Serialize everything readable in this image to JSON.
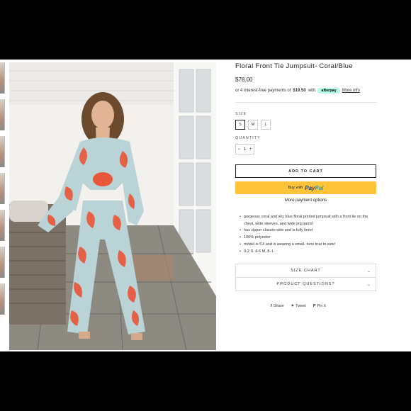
{
  "product": {
    "title": "Floral Front Tie Jumpsuit- Coral/Blue",
    "price": "$78.00",
    "afterpay_prefix": "or 4 interest-free payments of",
    "afterpay_amount": "$19.50",
    "afterpay_with": "with",
    "afterpay_badge": "afterpay",
    "afterpay_more": "More info"
  },
  "options": {
    "size_label": "SIZE",
    "sizes": [
      "S",
      "M",
      "L"
    ],
    "selected_size": "S",
    "quantity_label": "QUANTITY",
    "quantity": "1",
    "minus": "−",
    "plus": "+"
  },
  "buttons": {
    "add_to_cart": "ADD TO CART",
    "buy_with": "Buy with",
    "paypal_a": "Pay",
    "paypal_b": "Pal",
    "more_payment": "More payment options"
  },
  "description": [
    "gorgeous coral and sky blue floral printed jumpsuit with a front tie on the chest, wide sleeves, and wide leg pants!",
    "has zipper closure side and is fully lined",
    "100% polyester",
    "model is 5'4 and is wearing a small- runs true to size!",
    "0-2 S, 4-6 M, 8- L"
  ],
  "accordion": [
    {
      "label": "SIZE CHART",
      "icon": "chevron-down-icon"
    },
    {
      "label": "PRODUCT QUESTIONS?",
      "icon": "chevron-down-icon"
    }
  ],
  "share": {
    "facebook_icon": "f",
    "facebook": "Share",
    "twitter_icon": "🐦",
    "twitter": "Tweet",
    "pinterest_icon": "P",
    "pinterest": "Pin it"
  },
  "colors": {
    "paypal_yellow": "#ffc439",
    "afterpay_mint": "#b2fce4",
    "coral": "#e8573a",
    "sky_blue": "#b9d3d6"
  }
}
